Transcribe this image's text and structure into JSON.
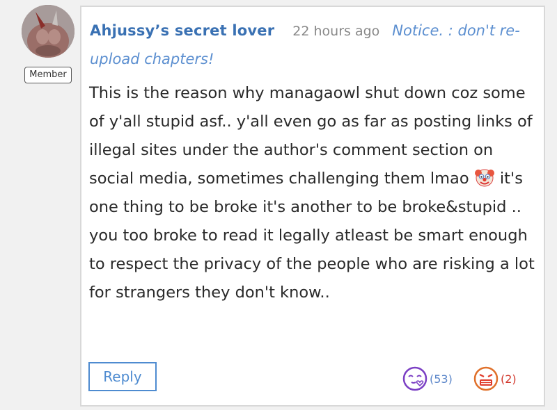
{
  "user": {
    "badge": "Member"
  },
  "comment": {
    "author": "Ahjussy’s secret lover",
    "time": "22 hours ago",
    "notice": "Notice. : don't re-upload chapters!",
    "body_part1": "This is the reason why managaowl shut down coz some of y'all stupid asf.. y'all even go as far as posting links of illegal sites under the author's comment section on social media, sometimes challenging them lmao ",
    "body_part2": " it's one thing to be broke it's another to be broke&stupid .. you too broke to read it legally atleast be smart enough to respect the privacy of the people who are risking a lot for strangers they don't know..",
    "emoji": "clown-face"
  },
  "actions": {
    "reply_label": "Reply",
    "reactions": [
      {
        "name": "love",
        "count": "(53)",
        "color": "#7b3fc4"
      },
      {
        "name": "angry",
        "count": "(2)",
        "color": "#e0702a"
      }
    ]
  }
}
